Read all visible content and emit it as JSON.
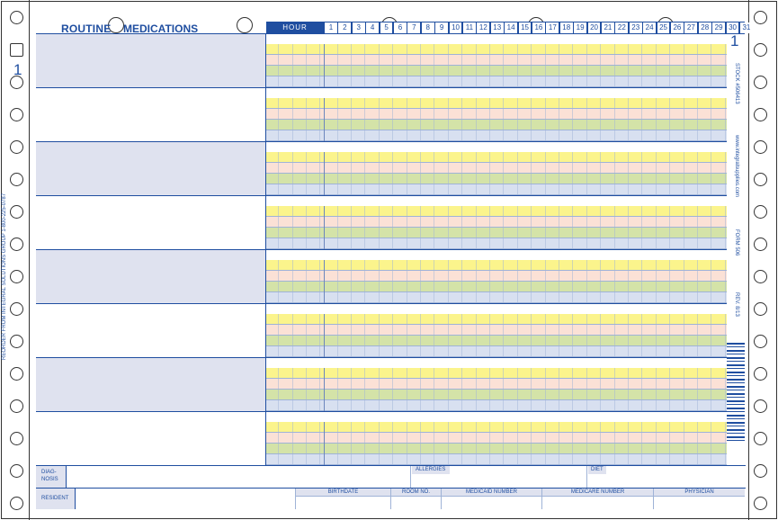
{
  "header": {
    "title_word1": "ROUTINE",
    "title_word2": "MEDICATIONS",
    "hour_label": "HOUR",
    "days": [
      "1",
      "2",
      "3",
      "4",
      "5",
      "6",
      "7",
      "8",
      "9",
      "10",
      "11",
      "12",
      "13",
      "14",
      "15",
      "16",
      "17",
      "18",
      "19",
      "20",
      "21",
      "22",
      "23",
      "24",
      "25",
      "26",
      "27",
      "28",
      "29",
      "30",
      "31"
    ],
    "page_number": "1",
    "left_number": "1"
  },
  "side_text": {
    "left": "REORDER FROM INTEGRAL SOLUTIONS GROUP 1-800-225-0787",
    "right_stock": "STOCK #506413",
    "right_url": "www.integralsupplies.com",
    "right_form": "FORM 506",
    "right_rev": "REV. 8/13"
  },
  "bottom": {
    "diagnosis_label_1": "DIAG-",
    "diagnosis_label_2": "NOSIS",
    "allergies_label": "ALLERGIES",
    "diet_label": "DIET",
    "resident_label": "RESIDENT",
    "birthdate_label": "BIRTHDATE",
    "room_label": "ROOM NO.",
    "medicaid_label": "MEDICAID NUMBER",
    "medicare_label": "MEDICARE NUMBER",
    "physician_label": "PHYSICIAN"
  },
  "colors": {
    "brand_blue": "#1f4ea0",
    "row_yellow": "#fbf48c",
    "row_pink": "#fbe1d6",
    "row_green": "#d4e3a8",
    "row_blue": "#d8e0f0",
    "shade": "#dfe2ef"
  }
}
